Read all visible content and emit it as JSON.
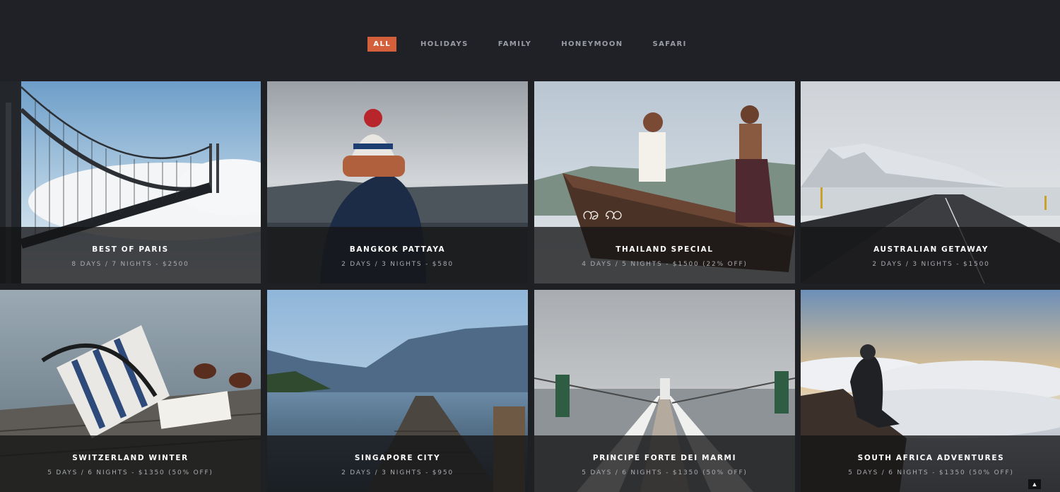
{
  "filters": [
    {
      "label": "ALL",
      "active": true
    },
    {
      "label": "HOLIDAYS",
      "active": false
    },
    {
      "label": "FAMILY",
      "active": false
    },
    {
      "label": "HONEYMOON",
      "active": false
    },
    {
      "label": "SAFARI",
      "active": false
    }
  ],
  "tours": [
    {
      "title": "BEST OF PARIS",
      "meta": "8 DAYS / 7 NIGHTS - $2500",
      "image": "golden-gate-bridge-in-fog"
    },
    {
      "title": "BANGKOK PATTAYA",
      "meta": "2 DAYS / 3 NIGHTS - $580",
      "image": "person-in-beanie-overlooking-lake"
    },
    {
      "title": "THAILAND SPECIAL",
      "meta": "4 DAYS / 5 NIGHTS - $1500 (22% OFF)",
      "image": "two-men-on-wooden-boat"
    },
    {
      "title": "AUSTRALIAN GETAWAY",
      "meta": "2 DAYS / 3 NIGHTS - $1500",
      "image": "road-to-snowy-mountain"
    },
    {
      "title": "SWITZERLAND WINTER",
      "meta": "5 DAYS / 6 NIGHTS - $1350 (50% OFF)",
      "image": "bag-and-sunglasses-on-dock"
    },
    {
      "title": "SINGAPORE CITY",
      "meta": "2 DAYS / 3 NIGHTS - $950",
      "image": "wooden-pier-on-mountain-lake"
    },
    {
      "title": "PRINCIPE FORTE DEI MARMI",
      "meta": "5 DAYS / 6 NIGHTS - $1350 (50% OFF)",
      "image": "pier-to-lighthouse"
    },
    {
      "title": "SOUTH AFRICA ADVENTURES",
      "meta": "5 DAYS / 6 NIGHTS - $1350 (50% OFF)",
      "image": "man-above-sea-of-clouds"
    }
  ],
  "scroll_top_icon": "chevron-up-icon"
}
